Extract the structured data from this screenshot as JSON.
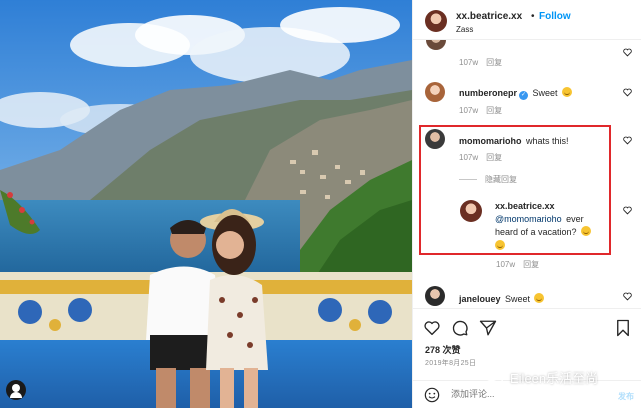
{
  "header": {
    "username": "xx.beatrice.xx",
    "separator": "•",
    "follow_label": "Follow",
    "location": "Zass",
    "more_label": "···"
  },
  "comments": [
    {
      "time": "107w",
      "reply_label": "回复"
    },
    {
      "username": "numberonepr",
      "verified": true,
      "text": "Sweet",
      "emoji": "smiling-face-emoji",
      "time": "107w",
      "reply_label": "回复"
    },
    {
      "username": "momomarioho",
      "text": "whats this!",
      "time": "107w",
      "reply_label": "回复",
      "hide_replies_label": "隐藏回复",
      "reply": {
        "username": "xx.beatrice.xx",
        "mention": "@momomarioho",
        "text": "ever heard of a vacation?",
        "emoji": "smiling-face-emoji",
        "time": "107w",
        "reply_label": "回复"
      }
    },
    {
      "username": "janelouey",
      "text": "Sweet",
      "emoji": "smiling-face-emoji"
    }
  ],
  "likes": {
    "count": "278",
    "label": "次赞"
  },
  "date": "2019年8月25日",
  "add_comment": {
    "placeholder": "添加评论...",
    "post_label": "发布"
  },
  "watermark": {
    "text": "Eileen乐活至尚"
  },
  "colors": {
    "follow": "#0095f6",
    "highlight": "#e0282b",
    "verified": "#3897f0"
  }
}
